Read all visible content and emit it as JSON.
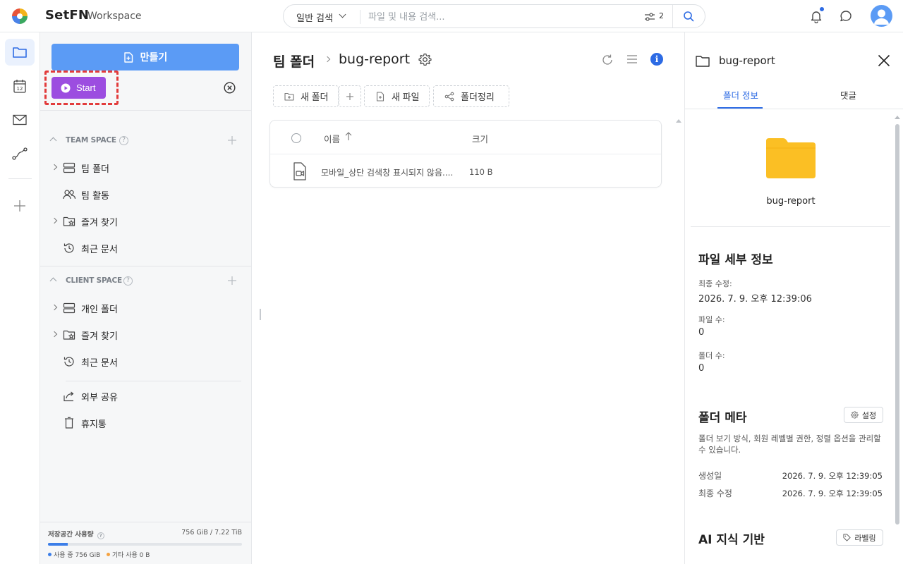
{
  "header": {
    "brand": "SetFN",
    "brand_sub": "Workspace",
    "search_type": "일반 검색",
    "search_placeholder": "파일 및 내용 검색...",
    "filter_count": "2"
  },
  "sidebar": {
    "create_label": "만들기",
    "start_label": "Start",
    "team_space": {
      "title": "TEAM SPACE",
      "items": [
        {
          "label": "팀 폴더",
          "icon": "server-stack-icon",
          "expandable": true
        },
        {
          "label": "팀 활동",
          "icon": "people-icon",
          "expandable": false
        },
        {
          "label": "즐겨 찾기",
          "icon": "star-folder-icon",
          "expandable": true
        },
        {
          "label": "최근 문서",
          "icon": "history-icon",
          "expandable": false
        }
      ]
    },
    "client_space": {
      "title": "CLIENT SPACE",
      "items": [
        {
          "label": "개인 폴더",
          "icon": "server-stack-icon",
          "expandable": true
        },
        {
          "label": "즐겨 찾기",
          "icon": "star-folder-icon",
          "expandable": true
        },
        {
          "label": "최근 문서",
          "icon": "history-icon",
          "expandable": false
        }
      ]
    },
    "extra_items": [
      {
        "label": "외부 공유",
        "icon": "share-icon"
      },
      {
        "label": "휴지통",
        "icon": "trash-icon"
      }
    ],
    "storage": {
      "label": "저장공간 사용량",
      "value": "756 GiB / 7.22 TiB",
      "used_fraction": 0.1,
      "legend_used": "사용 중 756 GiB",
      "legend_other": "기타 사용 0 B",
      "used_color": "#3c7ee8",
      "other_color": "#f5a341"
    }
  },
  "main": {
    "breadcrumb_root": "팀 폴더",
    "breadcrumb_current": "bug-report",
    "toolbar": {
      "new_folder": "새 폴더",
      "new_file": "새 파일",
      "organize": "폴더정리"
    },
    "table": {
      "col_name": "이름",
      "col_size": "크기",
      "rows": [
        {
          "name": "모바일_상단 검색창 표시되지 않음....",
          "size": "110 B",
          "icon": "video-file-icon"
        }
      ]
    }
  },
  "panel": {
    "title": "bug-report",
    "tab_info": "폴더 정보",
    "tab_comments": "댓글",
    "folder_name": "bug-report",
    "details_title": "파일 세부 정보",
    "last_modified_label": "최종 수정:",
    "last_modified_value": "2026. 7. 9. 오후 12:39:06",
    "file_count_label": "파일 수:",
    "file_count_value": "0",
    "folder_count_label": "폴더 수:",
    "folder_count_value": "0",
    "meta_title": "폴더 메타",
    "meta_button": "설정",
    "meta_desc": "폴더 보기 방식, 회원 레벨별 권한, 정렬 옵션을 관리할 수 있습니다.",
    "created_label": "생성일",
    "created_value": "2026. 7. 9. 오후 12:39:05",
    "modified_label": "최종 수정",
    "modified_value": "2026. 7. 9. 오후 12:39:05",
    "ai_title": "AI 지식 기반",
    "ai_button": "라벨링"
  },
  "colors": {
    "accent": "#2d6be4",
    "create_button": "#5b9bf5",
    "start_button": "#9c4de0",
    "folder": "#fbbf24"
  }
}
